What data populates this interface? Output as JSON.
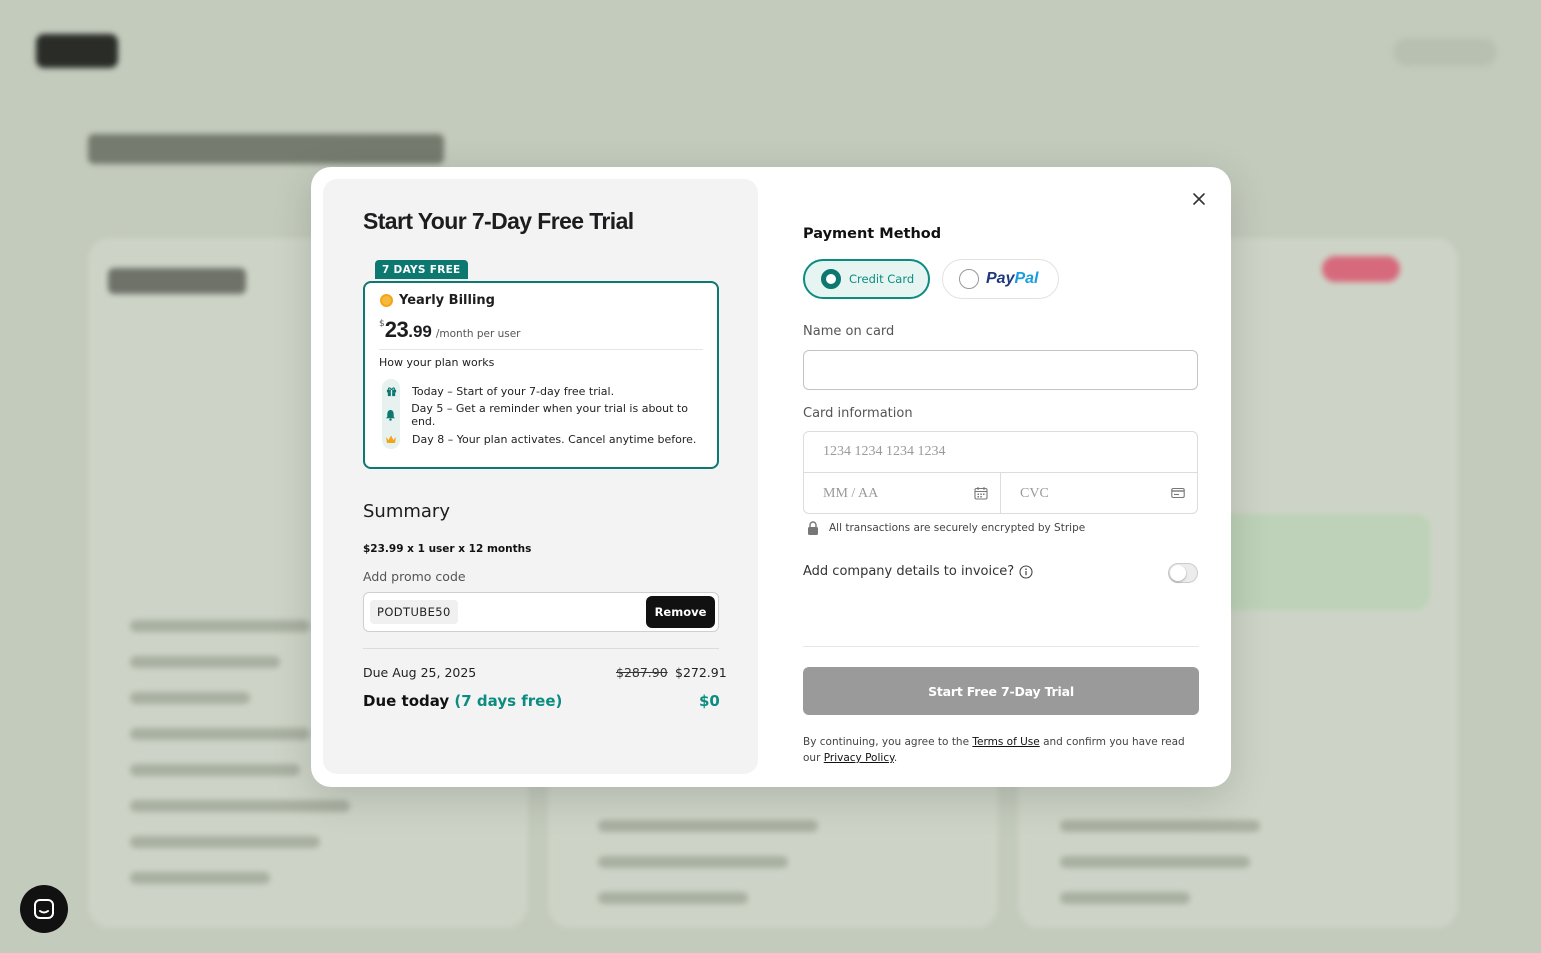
{
  "modal": {
    "title": "Start Your 7-Day Free Trial",
    "close_icon": "close-icon"
  },
  "plan": {
    "tag": "7 DAYS FREE",
    "name": "Yearly Billing",
    "currency": "$",
    "price_whole": "23",
    "price_cents": ".99",
    "per": "/month per user",
    "how_title": "How your plan works",
    "steps": [
      {
        "icon": "gift-icon",
        "text": "Today – Start of your 7-day free trial."
      },
      {
        "icon": "bell-icon",
        "text": "Day 5 – Get a reminder when your trial is about to end."
      },
      {
        "icon": "crown-icon",
        "text": "Day 8 – Your plan activates. Cancel anytime before."
      }
    ]
  },
  "summary": {
    "title": "Summary",
    "line": "$23.99  x 1 user x 12 months",
    "promo_label": "Add promo code",
    "promo_code": "PODTUBE50",
    "remove_label": "Remove",
    "due_label": "Due Aug 25, 2025",
    "due_old": "$287.90",
    "due_new": "$272.91",
    "today_label": "Due today",
    "today_free": "(7 days free)",
    "today_amount": "$0"
  },
  "payment": {
    "title": "Payment Method",
    "options": [
      {
        "label": "Credit Card",
        "selected": true
      },
      {
        "label_part1": "Pay",
        "label_part2": "Pal",
        "selected": false
      }
    ],
    "name_label": "Name on card",
    "name_value": "",
    "card_label": "Card information",
    "card_number_placeholder": "1234 1234 1234 1234",
    "expiry_placeholder": "MM / AA",
    "cvc_placeholder": "CVC",
    "secure_text": "All transactions are securely encrypted by Stripe",
    "company_label": "Add company details to invoice?",
    "company_toggle_on": false,
    "start_label": "Start Free 7-Day Trial",
    "legal_prefix": "By continuing, you agree to the",
    "terms_label": "Terms of Use",
    "legal_middle": "and confirm you have read our",
    "privacy_label": "Privacy Policy",
    "legal_suffix": "."
  },
  "colors": {
    "accent": "#0c7870",
    "accent_text": "#0c8c80",
    "disabled_button": "#9a9a9a",
    "backdrop": "#c3cbbd"
  }
}
